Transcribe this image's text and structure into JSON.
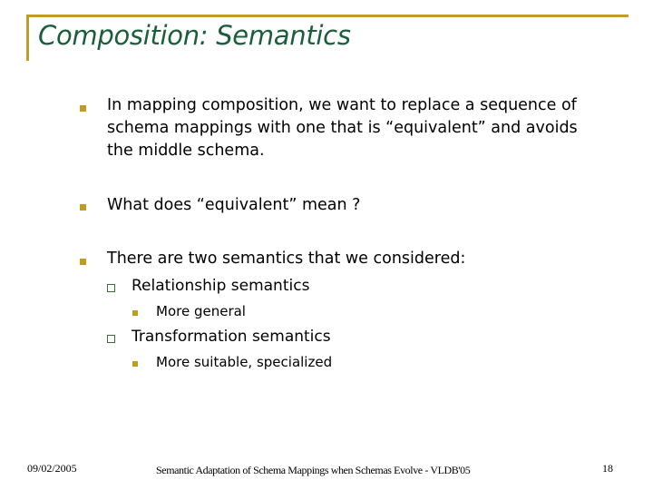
{
  "slide": {
    "title": "Composition: Semantics",
    "bullets": [
      {
        "lines": [
          "In mapping composition, we want to replace a sequence of",
          "schema mappings with one that is “equivalent” and avoids",
          "the middle schema."
        ]
      },
      {
        "text": "What does “equivalent” mean ?"
      },
      {
        "text": "There are two semantics that we considered:",
        "children": [
          {
            "text": "Relationship semantics",
            "children": [
              {
                "text": "More general"
              }
            ]
          },
          {
            "text": "Transformation semantics",
            "children": [
              {
                "text": "More suitable, specialized"
              }
            ]
          }
        ]
      }
    ]
  },
  "footer": {
    "date": "09/02/2005",
    "center": "Semantic Adaptation of Schema Mappings when Schemas Evolve  -  VLDB'05",
    "page": "18"
  },
  "colors": {
    "title": "#1b5e3b",
    "accent": "#c49a2a",
    "bullet": "#c39b1f",
    "sub_bullet_border": "#3c6b3c"
  }
}
